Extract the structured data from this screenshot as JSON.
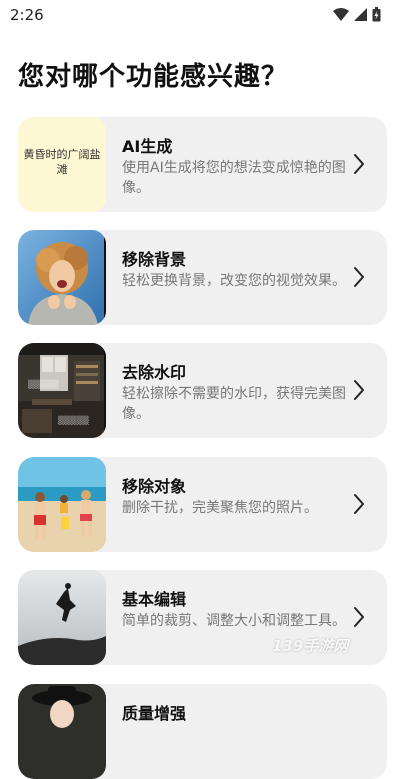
{
  "status": {
    "time": "2:26"
  },
  "page": {
    "title": "您对哪个功能感兴趣？"
  },
  "features": [
    {
      "title": "AI生成",
      "desc": "使用AI生成将您的想法变成惊艳的图像。",
      "thumb_text": "黄昏时的广阔盐滩"
    },
    {
      "title": "移除背景",
      "desc": "轻松更换背景，改变您的视觉效果。"
    },
    {
      "title": "去除水印",
      "desc": "轻松擦除不需要的水印，获得完美图像。"
    },
    {
      "title": "移除对象",
      "desc": "删除干扰，完美聚焦您的照片。"
    },
    {
      "title": "基本编辑",
      "desc": "简单的裁剪、调整大小和调整工具。"
    },
    {
      "title": "质量增强",
      "desc": ""
    }
  ],
  "watermark": {
    "text": "139手游网"
  },
  "icons": [
    "wifi-icon",
    "signal-icon",
    "battery-icon",
    "chevron-right-icon"
  ],
  "colors": {
    "card_bg": "#f0f0f0",
    "ai_thumb_bg": "#fdf7d3"
  }
}
